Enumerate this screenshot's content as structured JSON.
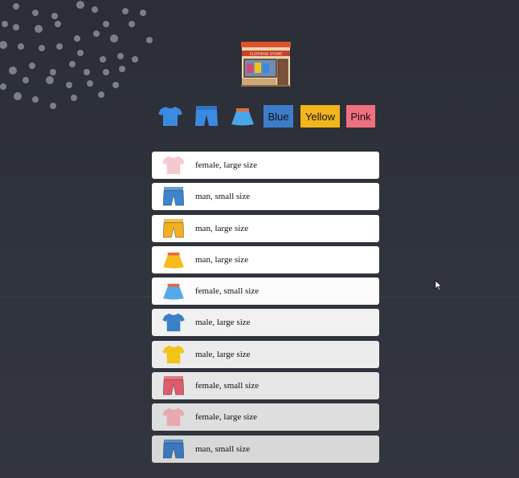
{
  "header": {
    "store_sign": "CLOTHING STORE"
  },
  "filters": {
    "icons": [
      {
        "name": "tshirt-filter-icon",
        "color": "#3a8be0"
      },
      {
        "name": "shorts-filter-icon",
        "color": "#3a8be0"
      },
      {
        "name": "skirt-filter-icon",
        "color": "#3a8be0"
      }
    ],
    "buttons": [
      {
        "label": "Blue",
        "bg": "#3d7cc9"
      },
      {
        "label": "Yellow",
        "bg": "#f2b61c"
      },
      {
        "label": "Pink",
        "bg": "#f07080"
      }
    ]
  },
  "items": [
    {
      "label": "female, large size",
      "icon": "tshirt-icon",
      "color": "#f7c8cf"
    },
    {
      "label": "man, small size",
      "icon": "shorts-icon",
      "color": "#3f84cf"
    },
    {
      "label": "man, large size",
      "icon": "shorts-icon",
      "color": "#f2b022"
    },
    {
      "label": "man, large size",
      "icon": "skirt-icon",
      "color": "#f7bb1d"
    },
    {
      "label": "female, small size",
      "icon": "skirt-icon",
      "color": "#54a8e8"
    },
    {
      "label": "male, large size",
      "icon": "tshirt-icon",
      "color": "#3b7fc6"
    },
    {
      "label": "male, large size",
      "icon": "tshirt-icon",
      "color": "#f2c31a"
    },
    {
      "label": "female, small size",
      "icon": "shorts-icon",
      "color": "#e05c6c"
    },
    {
      "label": "female, large size",
      "icon": "tshirt-icon",
      "color": "#e8a8b0"
    },
    {
      "label": "man, small size",
      "icon": "shorts-icon",
      "color": "#3a78bf"
    }
  ]
}
